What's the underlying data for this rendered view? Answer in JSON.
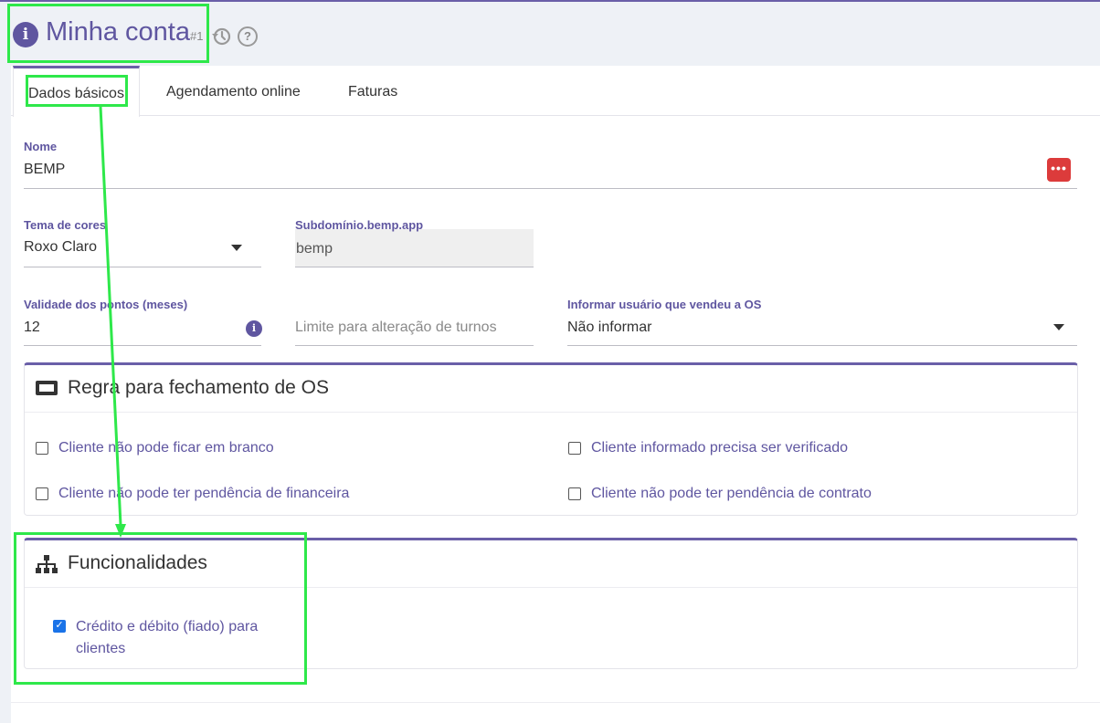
{
  "header": {
    "title": "Minha conta",
    "record_number": "#1",
    "info_icon": "info-circle-icon",
    "history_icon": "history-icon",
    "help_icon": "question-circle-icon"
  },
  "tabs": [
    {
      "label": "Dados básicos",
      "active": true
    },
    {
      "label": "Agendamento online",
      "active": false
    },
    {
      "label": "Faturas",
      "active": false
    }
  ],
  "form": {
    "nome": {
      "label": "Nome",
      "value": "BEMP"
    },
    "tema": {
      "label": "Tema de cores",
      "value": "Roxo Claro"
    },
    "subdominio": {
      "label": "Subdomínio.bemp.app",
      "value": "bemp"
    },
    "validade": {
      "label": "Validade dos pontos (meses)",
      "value": "12"
    },
    "limite": {
      "placeholder": "Limite para alteração de turnos"
    },
    "informar": {
      "label": "Informar usuário que vendeu a OS",
      "value": "Não informar"
    }
  },
  "regra_card": {
    "title": "Regra para fechamento de OS",
    "icon": "ticket-icon",
    "checks": [
      {
        "label": "Cliente não pode ficar em branco",
        "checked": false
      },
      {
        "label": "Cliente informado precisa ser verificado",
        "checked": false
      },
      {
        "label": "Cliente não pode ter pendência de financeira",
        "checked": false
      },
      {
        "label": "Cliente não pode ter pendência de contrato",
        "checked": false
      }
    ]
  },
  "func_card": {
    "title": "Funcionalidades",
    "icon": "sitemap-icon",
    "checks": [
      {
        "label_line1": "Crédito e débito (fiado) para",
        "label_line2": "clientes",
        "checked": true
      }
    ]
  },
  "colors": {
    "accent": "#5f56a0",
    "highlight": "#2ee84a",
    "danger": "#dc3b3b"
  }
}
